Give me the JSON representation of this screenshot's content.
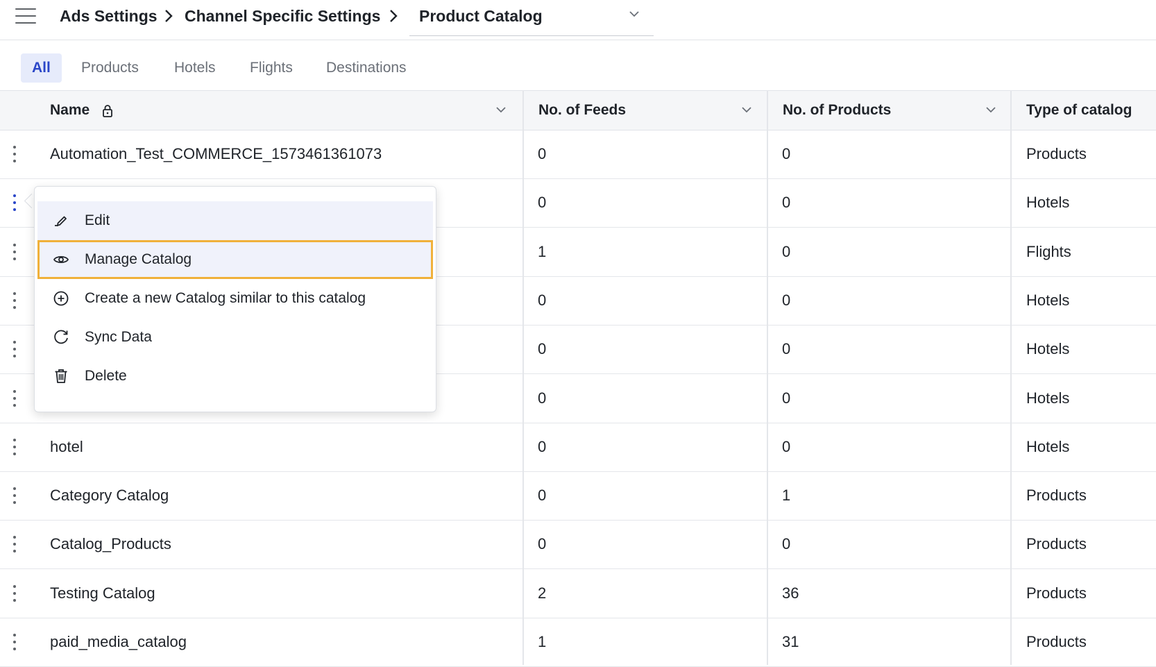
{
  "header": {
    "breadcrumb": [
      "Ads Settings",
      "Channel Specific Settings"
    ],
    "current_selection": "Product Catalog"
  },
  "tabs": [
    {
      "label": "All",
      "active": true
    },
    {
      "label": "Products",
      "active": false
    },
    {
      "label": "Hotels",
      "active": false
    },
    {
      "label": "Flights",
      "active": false
    },
    {
      "label": "Destinations",
      "active": false
    }
  ],
  "table": {
    "columns": [
      "Name",
      "No. of Feeds",
      "No. of Products",
      "Type of catalog"
    ],
    "rows": [
      {
        "name": "Automation_Test_COMMERCE_1573461361073",
        "feeds": "0",
        "products": "0",
        "type": "Products"
      },
      {
        "name": "",
        "feeds": "0",
        "products": "0",
        "type": "Hotels"
      },
      {
        "name": "",
        "feeds": "1",
        "products": "0",
        "type": "Flights"
      },
      {
        "name": "",
        "feeds": "0",
        "products": "0",
        "type": "Hotels"
      },
      {
        "name": "",
        "feeds": "0",
        "products": "0",
        "type": "Hotels"
      },
      {
        "name": "",
        "feeds": "0",
        "products": "0",
        "type": "Hotels"
      },
      {
        "name": "hotel",
        "feeds": "0",
        "products": "0",
        "type": "Hotels"
      },
      {
        "name": "Category Catalog",
        "feeds": "0",
        "products": "1",
        "type": "Products"
      },
      {
        "name": "Catalog_Products",
        "feeds": "0",
        "products": "0",
        "type": "Products"
      },
      {
        "name": "Testing Catalog",
        "feeds": "2",
        "products": "36",
        "type": "Products"
      },
      {
        "name": "paid_media_catalog",
        "feeds": "1",
        "products": "31",
        "type": "Products"
      }
    ]
  },
  "context_menu": {
    "items": [
      {
        "label": "Edit",
        "icon": "pencil-icon"
      },
      {
        "label": "Manage Catalog",
        "icon": "eye-icon"
      },
      {
        "label": "Create a new Catalog similar to this catalog",
        "icon": "plus-circle-icon"
      },
      {
        "label": "Sync Data",
        "icon": "refresh-icon"
      },
      {
        "label": "Delete",
        "icon": "trash-icon"
      }
    ]
  },
  "colors": {
    "accent": "#2a46c8",
    "active_tab_bg": "#e6ebfb",
    "focus_outline": "#f0b13a",
    "menu_hover_bg": "#f0f2fb"
  }
}
